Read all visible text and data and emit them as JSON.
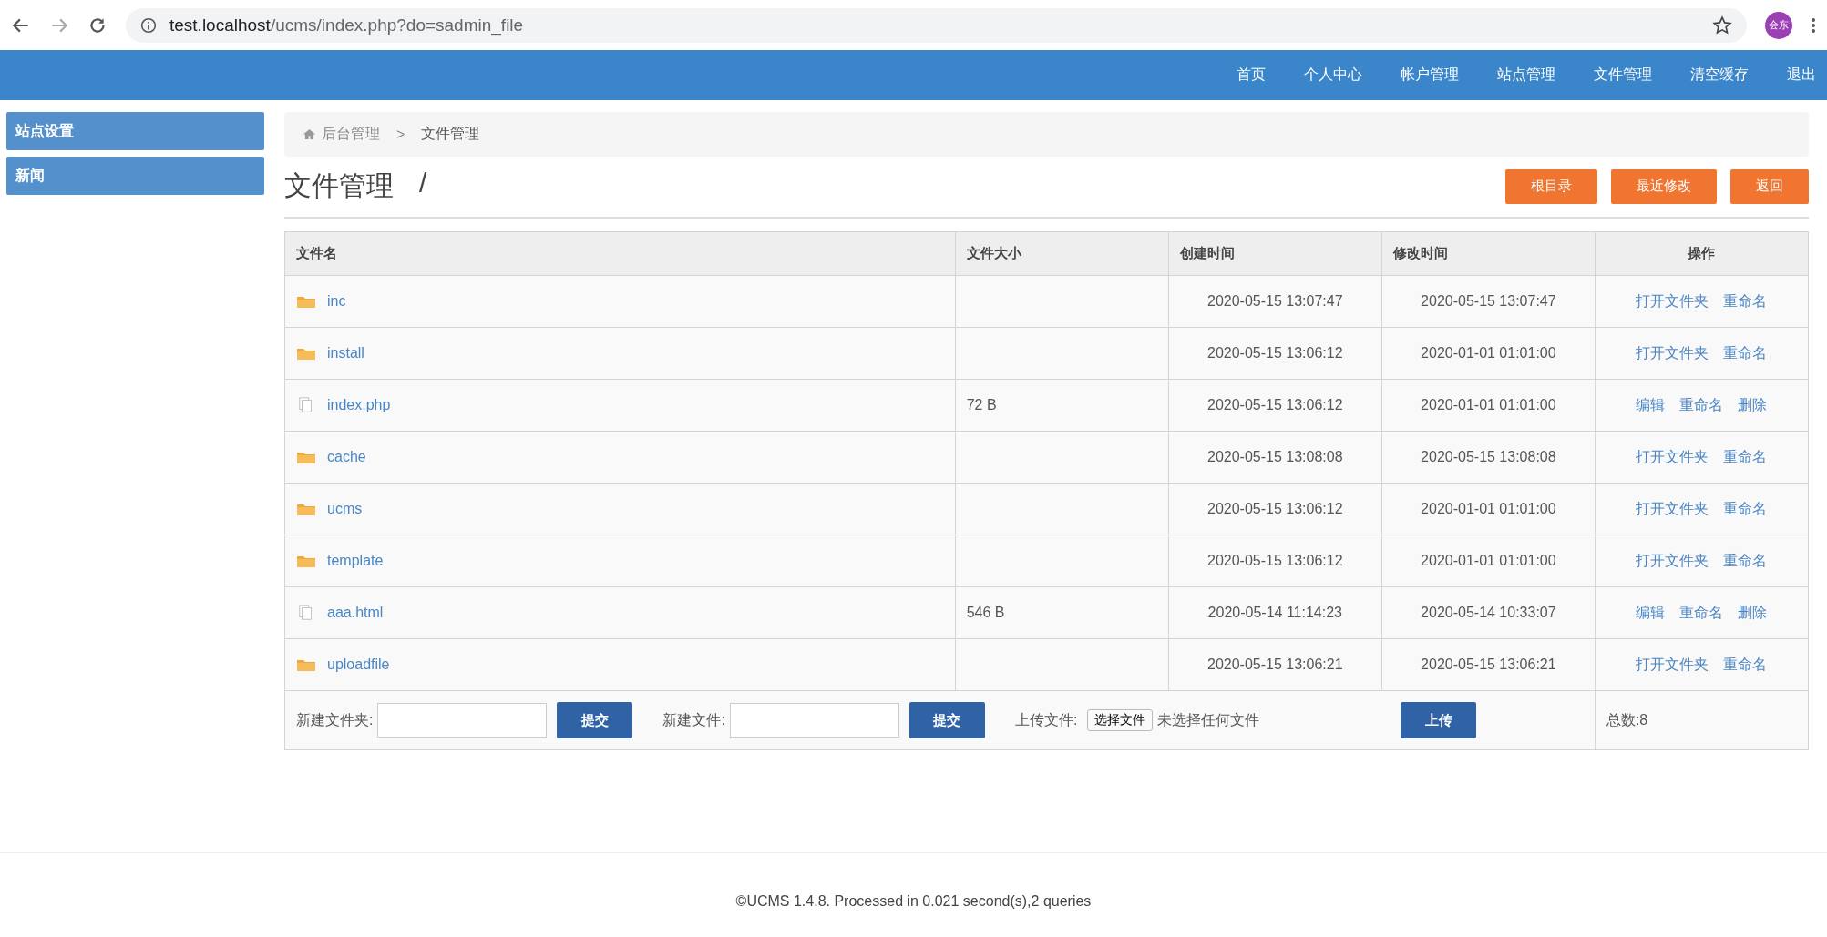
{
  "browser": {
    "url_host": "test.localhost",
    "url_path": "/ucms/index.php?do=sadmin_file",
    "avatar": "会东"
  },
  "nav": [
    "首页",
    "个人中心",
    "帐户管理",
    "站点管理",
    "文件管理",
    "清空缓存",
    "退出"
  ],
  "sidebar": {
    "items": [
      "站点设置",
      "新闻"
    ]
  },
  "breadcrumb": [
    "后台管理",
    ">",
    "文件管理"
  ],
  "page_title": "文件管理",
  "path": "/",
  "toolbar_buttons": [
    "根目录",
    "最近修改",
    "返回"
  ],
  "table": {
    "columns": [
      "文件名",
      "文件大小",
      "创建时间",
      "修改时间",
      "操作"
    ],
    "rows": [
      {
        "kind": "folder",
        "name": "inc",
        "size": "",
        "created": "2020-05-15 13:07:47",
        "modified": "2020-05-15 13:07:47",
        "actions": [
          "打开文件夹",
          "重命名"
        ]
      },
      {
        "kind": "folder",
        "name": "install",
        "size": "",
        "created": "2020-05-15 13:06:12",
        "modified": "2020-01-01 01:01:00",
        "actions": [
          "打开文件夹",
          "重命名"
        ]
      },
      {
        "kind": "file",
        "name": "index.php",
        "size": "72 B",
        "created": "2020-05-15 13:06:12",
        "modified": "2020-01-01 01:01:00",
        "actions": [
          "编辑",
          "重命名",
          "删除"
        ]
      },
      {
        "kind": "folder",
        "name": "cache",
        "size": "",
        "created": "2020-05-15 13:08:08",
        "modified": "2020-05-15 13:08:08",
        "actions": [
          "打开文件夹",
          "重命名"
        ]
      },
      {
        "kind": "folder",
        "name": "ucms",
        "size": "",
        "created": "2020-05-15 13:06:12",
        "modified": "2020-01-01 01:01:00",
        "actions": [
          "打开文件夹",
          "重命名"
        ]
      },
      {
        "kind": "folder",
        "name": "template",
        "size": "",
        "created": "2020-05-15 13:06:12",
        "modified": "2020-01-01 01:01:00",
        "actions": [
          "打开文件夹",
          "重命名"
        ]
      },
      {
        "kind": "file",
        "name": "aaa.html",
        "size": "546 B",
        "created": "2020-05-14 11:14:23",
        "modified": "2020-05-14 10:33:07",
        "actions": [
          "编辑",
          "重命名",
          "删除"
        ]
      },
      {
        "kind": "folder",
        "name": "uploadfile",
        "size": "",
        "created": "2020-05-15 13:06:21",
        "modified": "2020-05-15 13:06:21",
        "actions": [
          "打开文件夹",
          "重命名"
        ]
      }
    ]
  },
  "forms": {
    "new_folder_label": "新建文件夹:",
    "new_folder_submit": "提交",
    "new_file_label": "新建文件:",
    "new_file_submit": "提交",
    "upload_label": "上传文件:",
    "choose_file": "选择文件",
    "no_file": "未选择任何文件",
    "upload_submit": "上传",
    "total": "总数:8"
  },
  "footer": "©UCMS 1.4.8. Processed in 0.021 second(s),2 queries"
}
